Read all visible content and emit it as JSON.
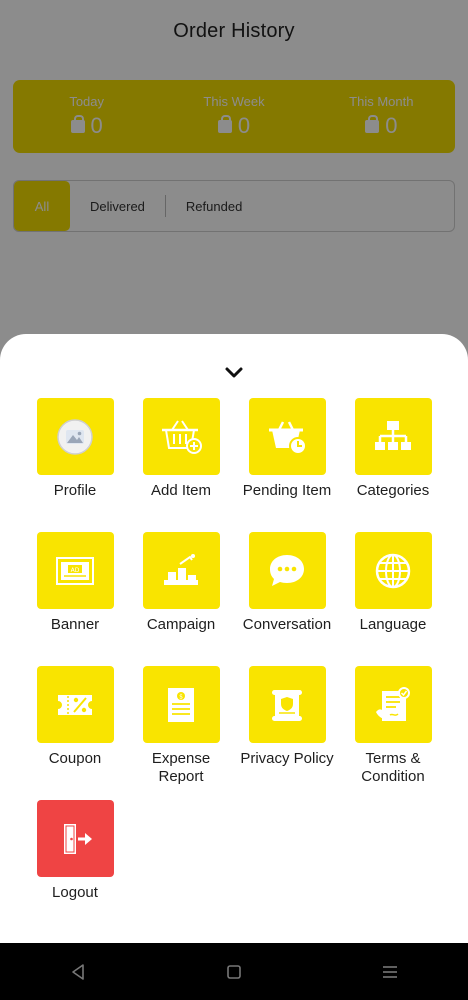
{
  "header": {
    "title": "Order History"
  },
  "stats": [
    {
      "label": "Today",
      "value": "0",
      "icon": "shopping-bag-icon"
    },
    {
      "label": "This Week",
      "value": "0",
      "icon": "shopping-bag-icon"
    },
    {
      "label": "This Month",
      "value": "0",
      "icon": "shopping-bag-icon"
    }
  ],
  "filters": {
    "all": "All",
    "delivered": "Delivered",
    "refunded": "Refunded",
    "active": "All"
  },
  "menu": {
    "collapse_icon": "chevron-down-icon",
    "items": [
      {
        "label": "Profile",
        "icon": "profile-image-icon"
      },
      {
        "label": "Add Item",
        "icon": "add-item-basket-icon"
      },
      {
        "label": "Pending Item",
        "icon": "pending-basket-icon"
      },
      {
        "label": "Categories",
        "icon": "categories-tree-icon"
      },
      {
        "label": "Banner",
        "icon": "banner-ad-icon"
      },
      {
        "label": "Campaign",
        "icon": "campaign-icon"
      },
      {
        "label": "Conversation",
        "icon": "chat-bubble-icon"
      },
      {
        "label": "Language",
        "icon": "globe-icon"
      },
      {
        "label": "Coupon",
        "icon": "coupon-icon"
      },
      {
        "label": "Expense Report",
        "icon": "expense-report-icon"
      },
      {
        "label": "Privacy Policy",
        "icon": "privacy-policy-icon"
      },
      {
        "label": "Terms & Condition",
        "icon": "terms-contract-icon"
      },
      {
        "label": "Logout",
        "icon": "logout-door-icon"
      }
    ]
  },
  "colors": {
    "accent": "#f9e400",
    "logout": "#ef4444",
    "scrim": "#000000"
  },
  "navbar": {
    "back_icon": "back-triangle-icon",
    "home_icon": "home-square-icon",
    "menu_icon": "menu-lines-icon"
  }
}
